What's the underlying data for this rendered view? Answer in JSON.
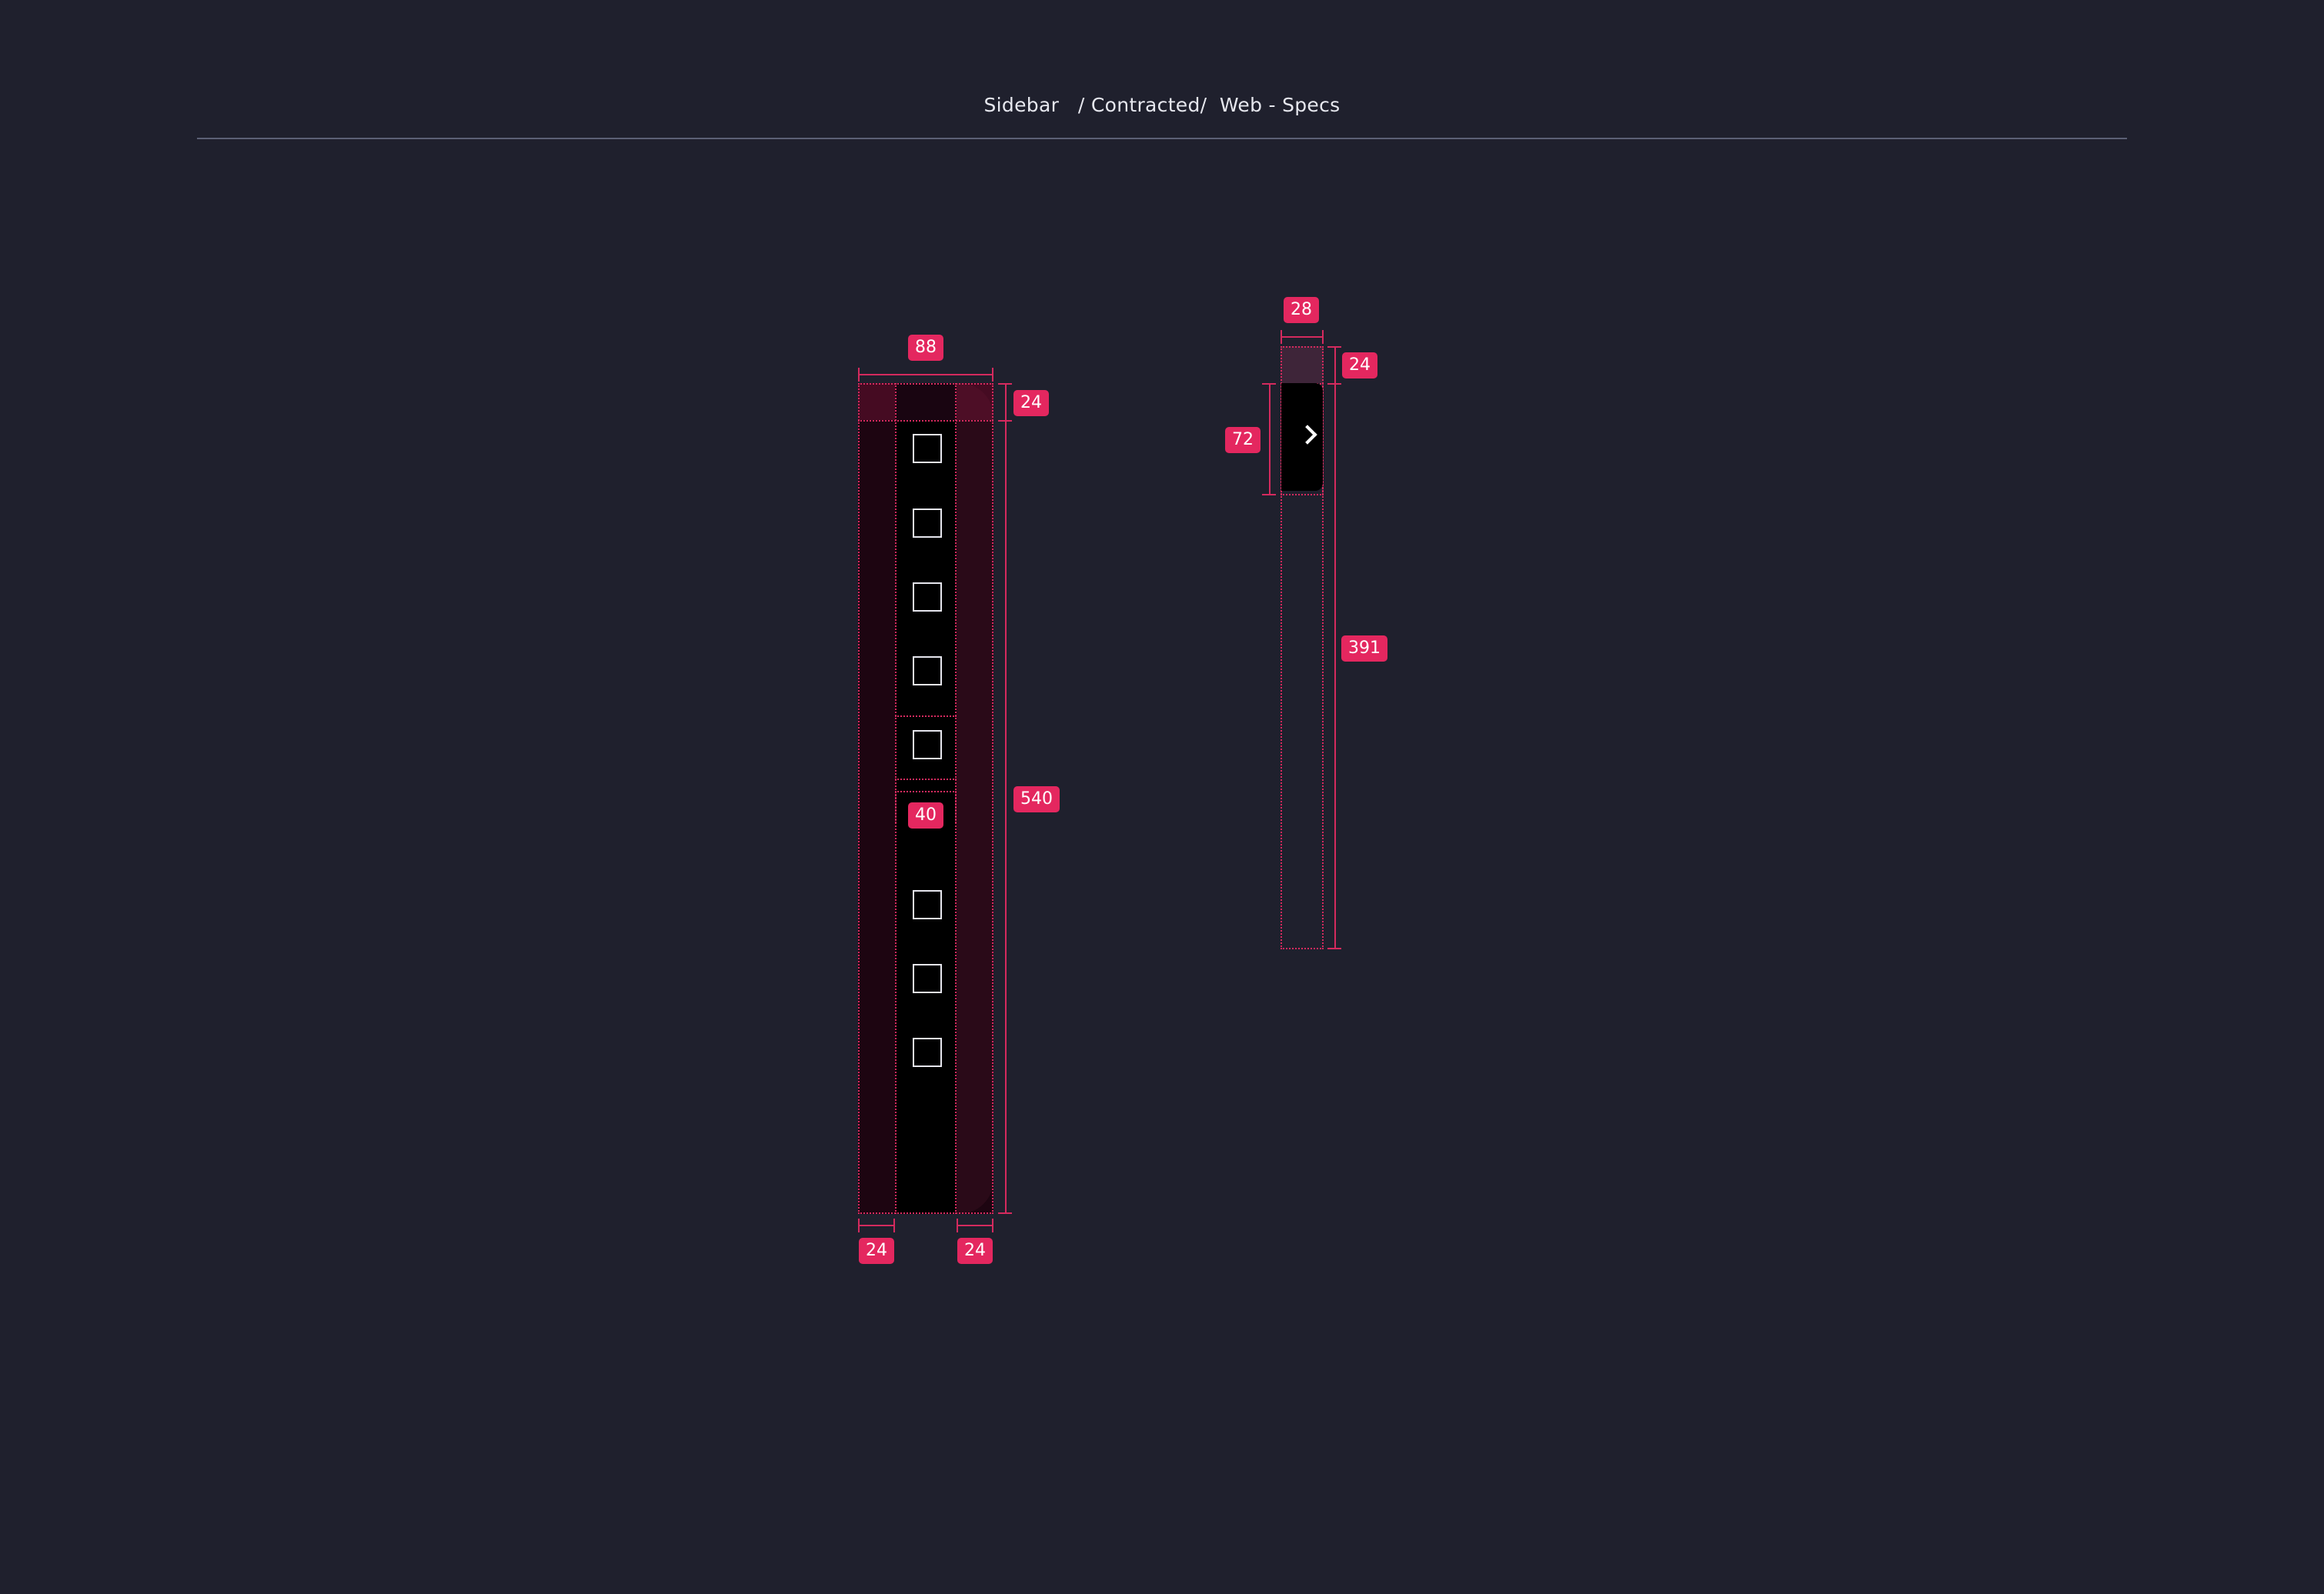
{
  "header": {
    "title": "Sidebar   / Contracted/  Web - Specs"
  },
  "colors": {
    "background": "#1f202d",
    "spec_accent": "#e4275f",
    "sidebar_fill": "#000000"
  },
  "sidebar": {
    "icons": [
      "square-icon",
      "square-icon",
      "square-icon",
      "square-icon",
      "square-icon",
      "square-icon",
      "square-icon",
      "square-icon"
    ],
    "measurements": {
      "width": "88",
      "top_padding": "24",
      "height": "540",
      "item_gap": "40",
      "left_padding": "24",
      "right_padding": "24"
    }
  },
  "collapse_tab": {
    "icon": "chevron-right-icon",
    "measurements": {
      "width": "28",
      "top_offset": "24",
      "button_height": "72",
      "track_height": "391"
    }
  }
}
